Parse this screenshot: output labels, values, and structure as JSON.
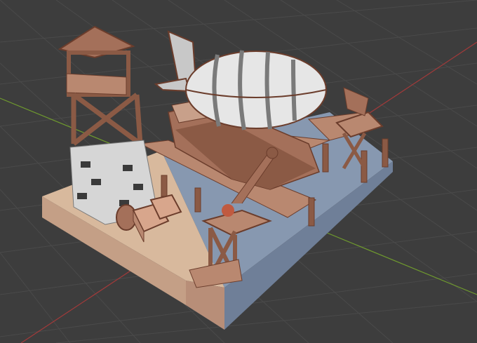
{
  "viewport": {
    "background": "#3d3d3d",
    "grid_color": "#4a4a4a",
    "x_axis_color": "#a33a3a",
    "y_axis_color": "#6f9a2e"
  },
  "scene": {
    "wood_light": "#c8a08a",
    "wood_mid": "#a4705a",
    "wood_dark": "#6b3d2c",
    "stone": "#d6d6d6",
    "stone_dark": "#3a3a3a",
    "water": "#8798b0",
    "sand": "#d8b99d",
    "balloon": "#e6e6e6",
    "balloon_band": "#7a7a7a"
  }
}
